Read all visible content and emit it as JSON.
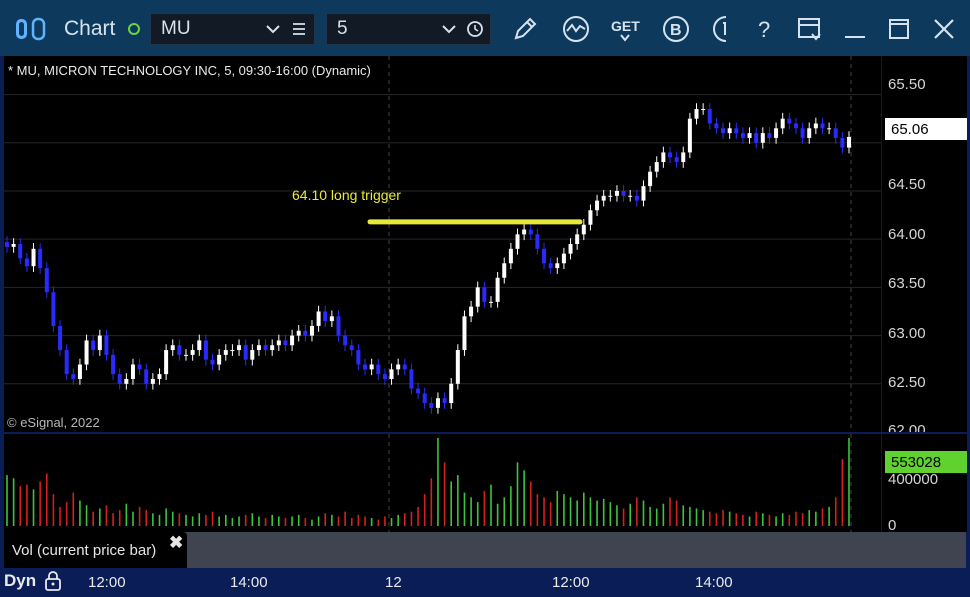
{
  "toolbar": {
    "title": "Chart",
    "symbol": "MU",
    "interval": "5",
    "get_label": "GET",
    "bold_label": "B",
    "help_label": "?"
  },
  "chart": {
    "header": "* MU, MICRON TECHNOLOGY INC, 5, 09:30-16:00 (Dynamic)",
    "copyright": "© eSignal, 2022",
    "annotation": "64.10 long trigger",
    "last_price": "65.06",
    "last_volume": "553028",
    "price_labels": [
      "65.50",
      "65.00",
      "64.50",
      "64.00",
      "63.50",
      "63.00",
      "62.50",
      "62.00"
    ],
    "volume_labels": [
      "400000",
      "0"
    ],
    "time_labels": [
      "12:00",
      "14:00",
      "12",
      "12:00",
      "14:00"
    ],
    "volume_panel_label": "Vol (current price bar)",
    "mode_label": "Dyn"
  },
  "colors": {
    "up": "#ffffff",
    "down": "#2a2aff",
    "vol_up": "#3cc43c",
    "vol_down": "#d42020",
    "annotation": "#e8e83a"
  },
  "chart_data": {
    "type": "candlestick",
    "symbol": "MU",
    "interval_minutes": 5,
    "y_range": [
      62.0,
      65.9
    ],
    "volume_range": [
      0,
      553028
    ],
    "last_price": 65.06,
    "closes": [
      63.92,
      63.95,
      63.8,
      63.72,
      63.9,
      63.7,
      63.45,
      63.1,
      62.85,
      62.6,
      62.55,
      62.7,
      62.95,
      62.85,
      63.0,
      62.8,
      62.6,
      62.5,
      62.55,
      62.7,
      62.65,
      62.5,
      62.55,
      62.6,
      62.85,
      62.9,
      62.8,
      62.8,
      62.85,
      62.95,
      62.75,
      62.7,
      62.8,
      62.85,
      62.85,
      62.9,
      62.75,
      62.85,
      62.9,
      62.85,
      62.9,
      62.95,
      62.9,
      63.0,
      63.05,
      63.0,
      63.1,
      63.25,
      63.15,
      63.2,
      63.0,
      62.9,
      62.85,
      62.7,
      62.65,
      62.7,
      62.6,
      62.55,
      62.65,
      62.7,
      62.65,
      62.45,
      62.4,
      62.3,
      62.25,
      62.35,
      62.3,
      62.5,
      62.85,
      63.2,
      63.3,
      63.5,
      63.35,
      63.35,
      63.6,
      63.75,
      63.9,
      64.05,
      64.1,
      64.05,
      63.9,
      63.75,
      63.7,
      63.75,
      63.85,
      63.95,
      64.05,
      64.15,
      64.3,
      64.4,
      64.45,
      64.45,
      64.5,
      64.45,
      64.45,
      64.4,
      64.55,
      64.7,
      64.8,
      64.9,
      64.85,
      64.8,
      64.9,
      65.25,
      65.35,
      65.35,
      65.2,
      65.15,
      65.1,
      65.15,
      65.1,
      65.05,
      65.1,
      65.0,
      65.1,
      65.05,
      65.15,
      65.25,
      65.2,
      65.15,
      65.05,
      65.15,
      65.2,
      65.15,
      65.15,
      65.05,
      64.95,
      65.06
    ],
    "volumes": [
      320000,
      300000,
      250000,
      260000,
      230000,
      280000,
      330000,
      200000,
      120000,
      150000,
      210000,
      160000,
      130000,
      90000,
      110000,
      130000,
      80000,
      100000,
      140000,
      90000,
      120000,
      100000,
      80000,
      70000,
      110000,
      90000,
      80000,
      70000,
      60000,
      80000,
      70000,
      90000,
      60000,
      70000,
      50000,
      60000,
      70000,
      80000,
      60000,
      50000,
      70000,
      60000,
      50000,
      60000,
      70000,
      50000,
      40000,
      60000,
      80000,
      70000,
      60000,
      90000,
      50000,
      70000,
      60000,
      50000,
      40000,
      60000,
      50000,
      70000,
      80000,
      90000,
      120000,
      200000,
      300000,
      553000,
      400000,
      280000,
      320000,
      210000,
      180000,
      150000,
      220000,
      260000,
      140000,
      180000,
      250000,
      400000,
      350000,
      280000,
      200000,
      180000,
      150000,
      220000,
      200000,
      180000,
      160000,
      210000,
      180000,
      160000,
      170000,
      150000,
      130000,
      110000,
      140000,
      180000,
      160000,
      120000,
      110000,
      140000,
      180000,
      160000,
      130000,
      120000,
      110000,
      100000,
      90000,
      80000,
      100000,
      90000,
      80000,
      70000,
      60000,
      90000,
      80000,
      70000,
      60000,
      80000,
      70000,
      90000,
      80000,
      100000,
      90000,
      110000,
      120000,
      180000,
      420000,
      553028
    ],
    "annotation": {
      "text": "64.10 long trigger",
      "price": 64.18
    }
  }
}
